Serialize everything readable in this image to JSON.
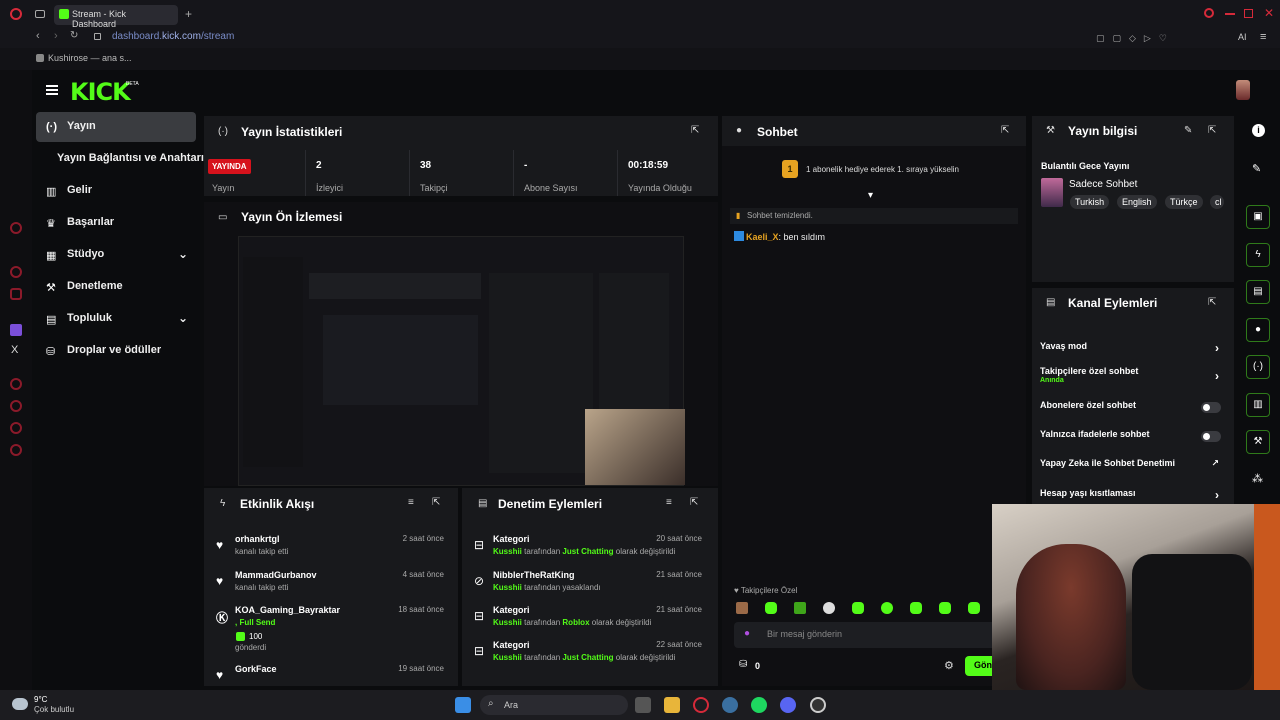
{
  "browser": {
    "tab_title": "Stream - Kick Dashboard",
    "url_domain": "dashboard.",
    "url_host": "kick.com",
    "url_path": "/stream",
    "bookmark": "Kushirose — ana s...",
    "ai_label": "AI"
  },
  "kick": {
    "logo": "KICK",
    "beta": "BETA"
  },
  "sidebar": {
    "items": [
      {
        "label": "Yayın",
        "icon": "broadcast-icon"
      },
      {
        "label": "Yayın Bağlantısı ve Anahtarı"
      },
      {
        "label": "Gelir",
        "icon": "bar-chart-icon"
      },
      {
        "label": "Başarılar",
        "icon": "trophy-icon"
      },
      {
        "label": "Stüdyo",
        "icon": "grid-icon"
      },
      {
        "label": "Denetleme",
        "icon": "wrench-icon"
      },
      {
        "label": "Topluluk",
        "icon": "users-icon"
      },
      {
        "label": "Droplar ve ödüller",
        "icon": "gift-icon"
      }
    ]
  },
  "stats": {
    "title": "Yayın İstatistikleri",
    "live_badge": "YAYINDA",
    "cells": [
      {
        "value": "",
        "label": "Yayın"
      },
      {
        "value": "2",
        "label": "İzleyici"
      },
      {
        "value": "38",
        "label": "Takipçi"
      },
      {
        "value": "-",
        "label": "Abone Sayısı"
      },
      {
        "value": "00:18:59",
        "label": "Yayında Olduğu"
      }
    ]
  },
  "preview": {
    "title": "Yayın Ön İzlemesi"
  },
  "activity": {
    "title": "Etkinlik Akışı",
    "items": [
      {
        "name": "orhankrtgl",
        "sub": "kanalı takip etti",
        "time": "2 saat önce"
      },
      {
        "name": "MammadGurbanov",
        "sub": "kanalı takip etti",
        "time": "4 saat önce"
      },
      {
        "name": "KOA_Gaming_Bayraktar",
        "sub_green": ", Full Send",
        "amount": "100",
        "sub2": "gönderdi",
        "time": "18 saat önce"
      },
      {
        "name": "GorkFace",
        "sub": "",
        "time": "19 saat önce"
      }
    ]
  },
  "moderation": {
    "title": "Denetim Eylemleri",
    "items": [
      {
        "name": "Kategori",
        "actor": "Kusshii",
        "mid": "tarafından",
        "target": "Just Chatting",
        "end": "olarak değiştirildi",
        "time": "20 saat önce"
      },
      {
        "name": "NibblerTheRatKing",
        "actor": "Kusshii",
        "mid": "tarafından yasaklandı",
        "target": "",
        "end": "",
        "time": "21 saat önce"
      },
      {
        "name": "Kategori",
        "actor": "Kusshii",
        "mid": "tarafından",
        "target": "Roblox",
        "end": "olarak değiştirildi",
        "time": "21 saat önce"
      },
      {
        "name": "Kategori",
        "actor": "Kusshii",
        "mid": "tarafından",
        "target": "Just Chatting",
        "end": "olarak değiştirildi",
        "time": "22 saat önce"
      }
    ]
  },
  "chat": {
    "title": "Sohbet",
    "gift_msg": "1 abonelik hediye ederek 1. sıraya yükselin",
    "gift_rank": "1",
    "cleared": "Sohbet temizlendi.",
    "message_user": "Kaeli_X",
    "message_text": ": ben sıldım",
    "followers_only": "Takipçilere Özel",
    "input_placeholder": "Bir mesaj gönderin",
    "points": "0",
    "send_label": "Gön"
  },
  "stream_info": {
    "title": "Yayın bilgisi",
    "stream_title": "Bulantılı Gece Yayını",
    "category": "Sadece Sohbet",
    "tags": [
      "Turkish",
      "English",
      "Türkçe",
      "cl"
    ]
  },
  "channel_actions": {
    "title": "Kanal Eylemleri",
    "items": [
      {
        "label": "Yavaş mod",
        "control": "chevron"
      },
      {
        "label": "Takipçilere özel sohbet",
        "sub": "Anında",
        "control": "chevron"
      },
      {
        "label": "Abonelere özel sohbet",
        "control": "toggle"
      },
      {
        "label": "Yalnızca ifadelerle sohbet",
        "control": "toggle"
      },
      {
        "label": "Yapay Zeka ile Sohbet Denetimi",
        "control": "external"
      },
      {
        "label": "Hesap yaşı kısıtlaması",
        "control": "chevron"
      }
    ]
  },
  "taskbar": {
    "weather_temp": "9°C",
    "weather_desc": "Çok bulutlu",
    "search": "Ara"
  },
  "colors": {
    "accent": "#53fc18",
    "live": "#d6121c",
    "panel": "#18191c",
    "bg": "#0b0c0e"
  }
}
